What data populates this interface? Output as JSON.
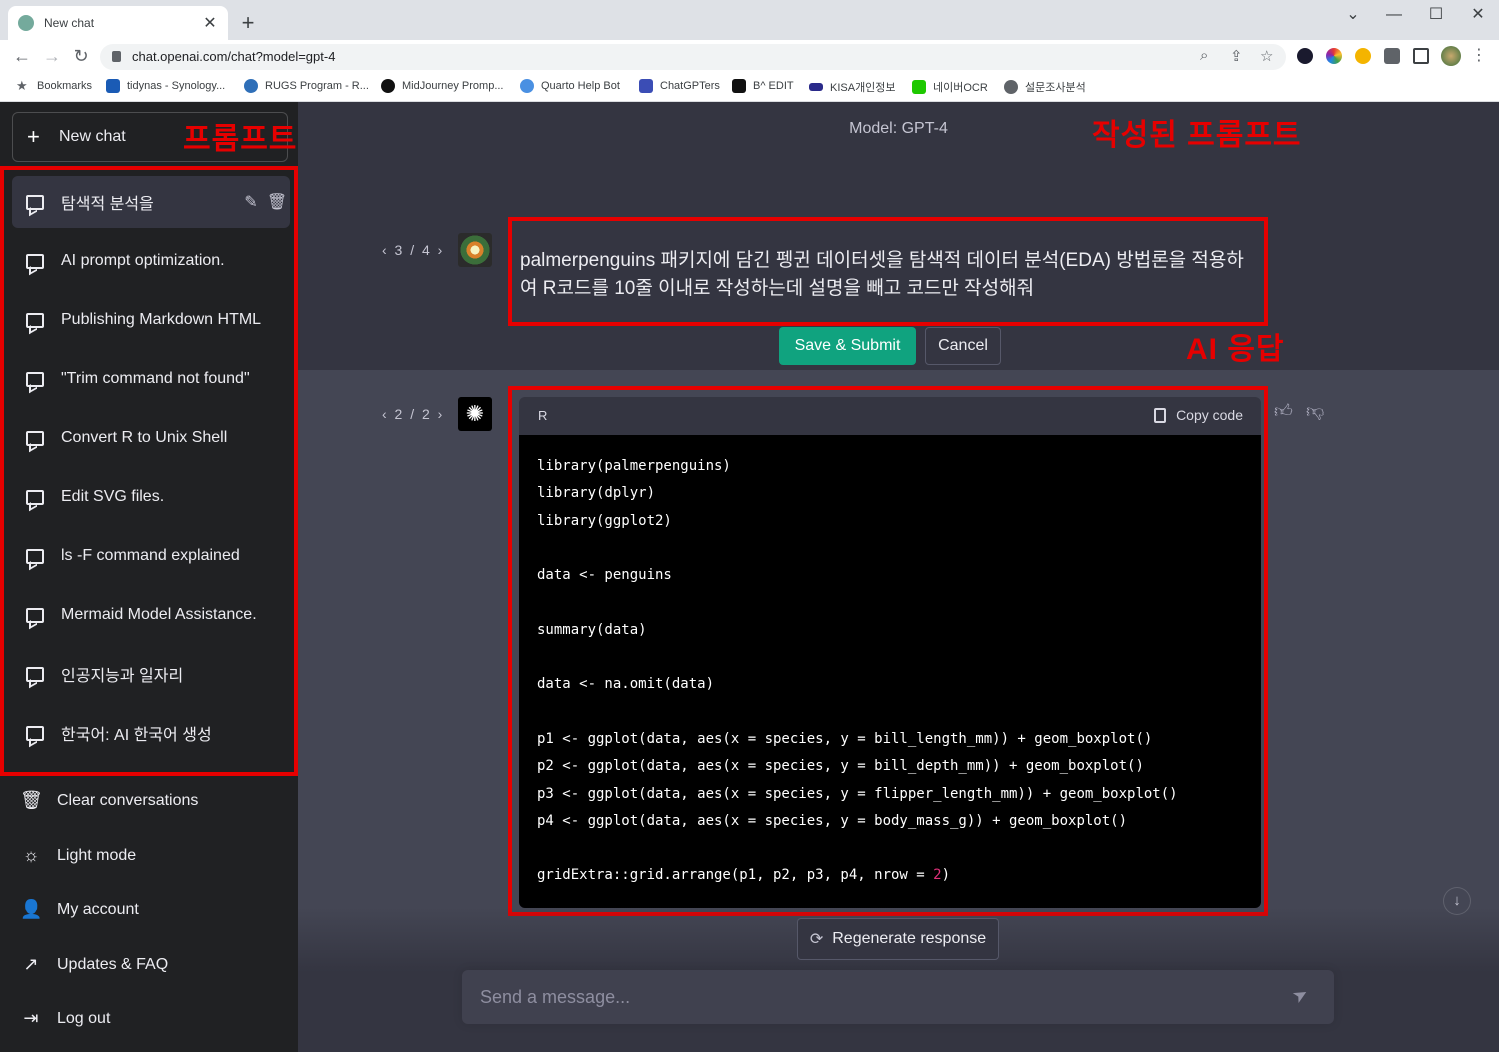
{
  "browser": {
    "tab_title": "New chat",
    "tab_close": "✕",
    "new_tab": "+",
    "window_controls": [
      "⌄",
      "—",
      "☐",
      "✕"
    ],
    "url": "chat.openai.com/chat?model=gpt-4",
    "bookmarks": [
      {
        "label": "Bookmarks",
        "color": "#5f6368"
      },
      {
        "label": "tidynas - Synology...",
        "color": "#1a5bb5"
      },
      {
        "label": "RUGS Program - R...",
        "color": "#2f6fb8"
      },
      {
        "label": "MidJourney Promp...",
        "color": "#111111"
      },
      {
        "label": "Quarto Help Bot",
        "color": "#4a90e2"
      },
      {
        "label": "ChatGPTers",
        "color": "#3b4db5"
      },
      {
        "label": "B^ EDIT",
        "color": "#111111"
      },
      {
        "label": "KISA개인정보",
        "color": "#2a2a8a"
      },
      {
        "label": "네이버OCR",
        "color": "#1ec800"
      },
      {
        "label": "설문조사분석",
        "color": "#5f6368"
      }
    ]
  },
  "sidebar": {
    "new_chat": "New chat",
    "annotation": "프롬프트 채팅 이력",
    "conversations": [
      "탐색적 분석을",
      "AI prompt optimization.",
      "Publishing Markdown HTML",
      "\"Trim command not found\"",
      "Convert R to Unix Shell",
      "Edit SVG files.",
      "ls -F command explained",
      "Mermaid Model Assistance.",
      "인공지능과 일자리",
      "한국어: AI 한국어 생성"
    ],
    "footer": [
      {
        "label": "Clear conversations",
        "icon": "trash-icon"
      },
      {
        "label": "Light mode",
        "icon": "sun-icon"
      },
      {
        "label": "My account",
        "icon": "user-icon"
      },
      {
        "label": "Updates & FAQ",
        "icon": "external-link-icon"
      },
      {
        "label": "Log out",
        "icon": "logout-icon"
      }
    ]
  },
  "main": {
    "model": "Model: GPT-4",
    "annotation_prompt": "작성된 프롬프트",
    "annotation_response": "AI 응답",
    "user_pager": "‹ 3 / 4 ›",
    "prompt_text": "palmerpenguins 패키지에 담긴 펭귄 데이터셋을 탐색적 데이터 분석(EDA) 방법론을 적용하여 R코드를 10줄 이내로 작성하는데 설명을 빼고 코드만 작성해줘",
    "save_submit": "Save & Submit",
    "cancel": "Cancel",
    "ai_pager": "‹ 2 / 2 ›",
    "code_lang": "R",
    "copy_code": "Copy code",
    "code_lines": [
      "library(palmerpenguins)",
      "library(dplyr)",
      "library(ggplot2)",
      "",
      "data <- penguins",
      "",
      "summary(data)",
      "",
      "data <- na.omit(data)",
      "",
      "p1 <- ggplot(data, aes(x = species, y = bill_length_mm)) + geom_boxplot()",
      "p2 <- ggplot(data, aes(x = species, y = bill_depth_mm)) + geom_boxplot()",
      "p3 <- ggplot(data, aes(x = species, y = flipper_length_mm)) + geom_boxplot()",
      "p4 <- ggplot(data, aes(x = species, y = body_mass_g)) + geom_boxplot()",
      "",
      "gridExtra::grid.arrange(p1, p2, p3, p4, nrow = "
    ],
    "code_last_number": "2",
    "code_last_close": ")",
    "regenerate": "Regenerate response",
    "message_placeholder": "Send a message..."
  },
  "colors": {
    "accent": "#10a37f",
    "annotation_red": "#e60000",
    "sidebar_bg": "#202123",
    "main_bg": "#343541",
    "ai_row_bg": "#444654"
  }
}
